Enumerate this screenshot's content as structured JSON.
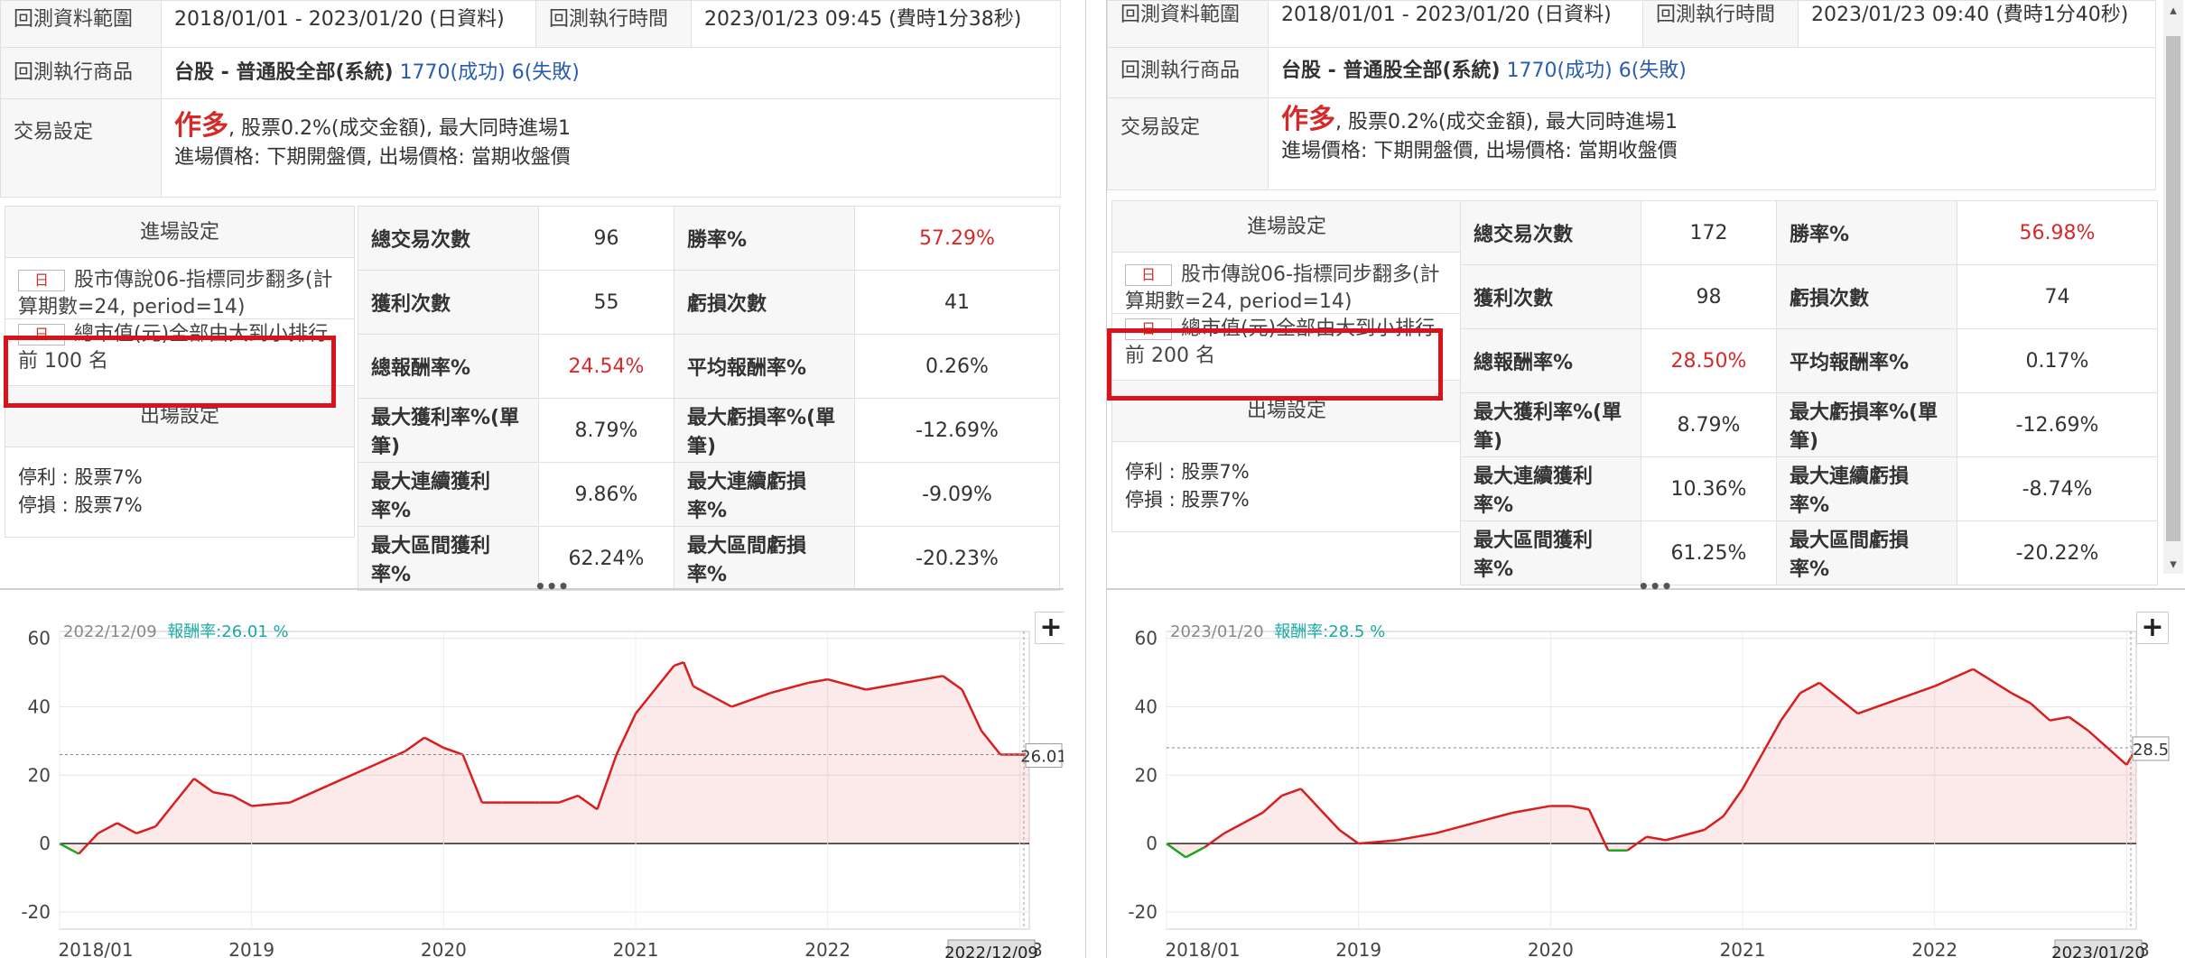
{
  "panels": [
    {
      "info": {
        "range_label": "回測資料範圍",
        "range_value": "2018/01/01 - 2023/01/20 (日資料)",
        "exec_time_label": "回測執行時間",
        "exec_time_value": "2023/01/23 09:45 (費時1分38秒)",
        "product_label": "回測執行商品",
        "product_value": "台股 - 普通股全部(系統)",
        "success": "1770(成功)",
        "fail": "6(失敗)",
        "trade_label": "交易設定",
        "trade_dir": "作多",
        "trade_line1": ", 股票0.2%(成交金額), 最大同時進場1",
        "trade_line2": "進場價格: 下期開盤價, 出場價格: 當期收盤價"
      },
      "entry_header": "進場設定",
      "conditions": [
        {
          "tag": "日",
          "text": "股市傳說06-指標同步翻多(計算期數=24, period=14)"
        },
        {
          "tag": "日",
          "text": "總市值(元)全部由大到小排行前 100 名"
        }
      ],
      "exit_header": "出場設定",
      "exit_rules": [
        "停利 : 股票7%",
        "停損 : 股票7%"
      ],
      "stats": [
        {
          "k1": "總交易次數",
          "v1": "96",
          "k2": "勝率%",
          "v2": "57.29%",
          "v2red": true
        },
        {
          "k1": "獲利次數",
          "v1": "55",
          "k2": "虧損次數",
          "v2": "41"
        },
        {
          "k1": "總報酬率%",
          "v1": "24.54%",
          "v1red": true,
          "k2": "平均報酬率%",
          "v2": "0.26%"
        },
        {
          "k1": "最大獲利率%(單筆)",
          "v1": "8.79%",
          "k2": "最大虧損率%(單筆)",
          "v2": "-12.69%"
        },
        {
          "k1": "最大連續獲利率%",
          "v1": "9.86%",
          "k2": "最大連續虧損率%",
          "v2": "-9.09%"
        },
        {
          "k1": "最大區間獲利率%",
          "v1": "62.24%",
          "k2": "最大區間虧損率%",
          "v2": "-20.23%"
        }
      ],
      "chart_hover_date": "2022/12/09",
      "chart_rate_label": "報酬率:",
      "chart_rate_value": "26.01 %",
      "chart_last_label": "26.01",
      "chart_cursor_label": "2022/12/09",
      "chart_data": {
        "type": "area",
        "x_ticks": [
          "2018/01",
          "2019",
          "2020",
          "2021",
          "2022",
          "2023"
        ],
        "y_ticks": [
          60,
          40,
          20,
          0,
          -20
        ],
        "ylim": [
          -25,
          62
        ],
        "series": [
          {
            "x": [
              2018.0,
              2018.1,
              2018.2,
              2018.3,
              2018.4,
              2018.5,
              2018.6,
              2018.7,
              2018.8,
              2018.9,
              2019.0,
              2019.2,
              2019.4,
              2019.6,
              2019.8,
              2019.9,
              2020.0,
              2020.1,
              2020.2,
              2020.3,
              2020.5,
              2020.6,
              2020.7,
              2020.8,
              2020.9,
              2021.0,
              2021.1,
              2021.2,
              2021.25,
              2021.3,
              2021.4,
              2021.5,
              2021.7,
              2021.9,
              2022.0,
              2022.2,
              2022.4,
              2022.6,
              2022.7,
              2022.8,
              2022.9,
              2023.0,
              2023.05
            ],
            "values": [
              0,
              -3,
              3,
              6,
              3,
              5,
              12,
              19,
              15,
              14,
              11,
              12,
              17,
              22,
              27,
              31,
              28,
              26,
              12,
              12,
              12,
              12,
              14,
              10,
              26,
              38,
              45,
              52,
              53,
              46,
              43,
              40,
              44,
              47,
              48,
              45,
              47,
              49,
              45,
              33,
              26,
              26,
              26
            ]
          }
        ]
      }
    },
    {
      "info": {
        "range_label": "回測資料範圍",
        "range_value": "2018/01/01 - 2023/01/20 (日資料)",
        "exec_time_label": "回測執行時間",
        "exec_time_value": "2023/01/23 09:40 (費時1分40秒)",
        "product_label": "回測執行商品",
        "product_value": "台股 - 普通股全部(系統)",
        "success": "1770(成功)",
        "fail": "6(失敗)",
        "trade_label": "交易設定",
        "trade_dir": "作多",
        "trade_line1": ", 股票0.2%(成交金額), 最大同時進場1",
        "trade_line2": "進場價格: 下期開盤價, 出場價格: 當期收盤價"
      },
      "entry_header": "進場設定",
      "conditions": [
        {
          "tag": "日",
          "text": "股市傳說06-指標同步翻多(計算期數=24, period=14)"
        },
        {
          "tag": "日",
          "text": "總市值(元)全部由大到小排行前 200 名"
        }
      ],
      "exit_header": "出場設定",
      "exit_rules": [
        "停利 : 股票7%",
        "停損 : 股票7%"
      ],
      "stats": [
        {
          "k1": "總交易次數",
          "v1": "172",
          "k2": "勝率%",
          "v2": "56.98%",
          "v2red": true
        },
        {
          "k1": "獲利次數",
          "v1": "98",
          "k2": "虧損次數",
          "v2": "74"
        },
        {
          "k1": "總報酬率%",
          "v1": "28.50%",
          "v1red": true,
          "k2": "平均報酬率%",
          "v2": "0.17%"
        },
        {
          "k1": "最大獲利率%(單筆)",
          "v1": "8.79%",
          "k2": "最大虧損率%(單筆)",
          "v2": "-12.69%"
        },
        {
          "k1": "最大連續獲利率%",
          "v1": "10.36%",
          "k2": "最大連續虧損率%",
          "v2": "-8.74%"
        },
        {
          "k1": "最大區間獲利率%",
          "v1": "61.25%",
          "k2": "最大區間虧損率%",
          "v2": "-20.22%"
        }
      ],
      "chart_hover_date": "2023/01/20",
      "chart_rate_label": "報酬率:",
      "chart_rate_value": "28.5 %",
      "chart_last_label": "28.5",
      "chart_cursor_label": "2023/01/20",
      "chart_data": {
        "type": "area",
        "x_ticks": [
          "2018/01",
          "2019",
          "2020",
          "2021",
          "2022",
          "2023"
        ],
        "y_ticks": [
          60,
          40,
          20,
          0,
          -20
        ],
        "ylim": [
          -25,
          62
        ],
        "series": [
          {
            "x": [
              2018.0,
              2018.1,
              2018.2,
              2018.3,
              2018.4,
              2018.5,
              2018.6,
              2018.7,
              2018.8,
              2018.9,
              2019.0,
              2019.2,
              2019.4,
              2019.6,
              2019.8,
              2020.0,
              2020.1,
              2020.2,
              2020.3,
              2020.4,
              2020.5,
              2020.6,
              2020.8,
              2020.9,
              2021.0,
              2021.1,
              2021.2,
              2021.3,
              2021.4,
              2021.6,
              2021.8,
              2022.0,
              2022.2,
              2022.4,
              2022.5,
              2022.6,
              2022.7,
              2022.8,
              2022.9,
              2023.0,
              2023.05
            ],
            "values": [
              0,
              -4,
              -1,
              3,
              6,
              9,
              14,
              16,
              10,
              4,
              0,
              1,
              3,
              6,
              9,
              11,
              11,
              10,
              -2,
              -2,
              2,
              1,
              4,
              8,
              16,
              26,
              36,
              44,
              47,
              38,
              42,
              46,
              51,
              44,
              41,
              36,
              37,
              33,
              28,
              23,
              28
            ]
          }
        ]
      }
    }
  ]
}
